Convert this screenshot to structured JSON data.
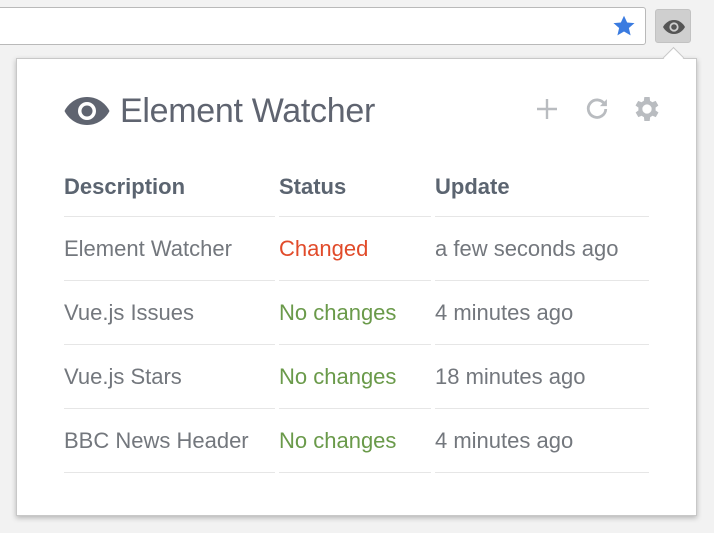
{
  "browser": {
    "bookmark_icon": "star-icon",
    "extension_icon": "eye-icon",
    "colors": {
      "star": "#3a7be0"
    }
  },
  "popup": {
    "logo_icon": "eye-icon",
    "title": "Element Watcher",
    "actions": [
      {
        "icon": "plus-icon"
      },
      {
        "icon": "refresh-icon"
      },
      {
        "icon": "gear-icon"
      }
    ],
    "table": {
      "headers": [
        "Description",
        "Status",
        "Update"
      ],
      "rows": [
        {
          "description": "Element Watcher",
          "status": "Changed",
          "update": "a few seconds ago"
        },
        {
          "description": "Vue.js Issues",
          "status": "No changes",
          "update": "4 minutes ago"
        },
        {
          "description": "Vue.js Stars",
          "status": "No changes",
          "update": "18 minutes ago"
        },
        {
          "description": "BBC News Header",
          "status": "No changes",
          "update": "4 minutes ago"
        }
      ]
    },
    "colors": {
      "changed": "#e14b2a",
      "no_changes": "#6a9a4a"
    }
  }
}
